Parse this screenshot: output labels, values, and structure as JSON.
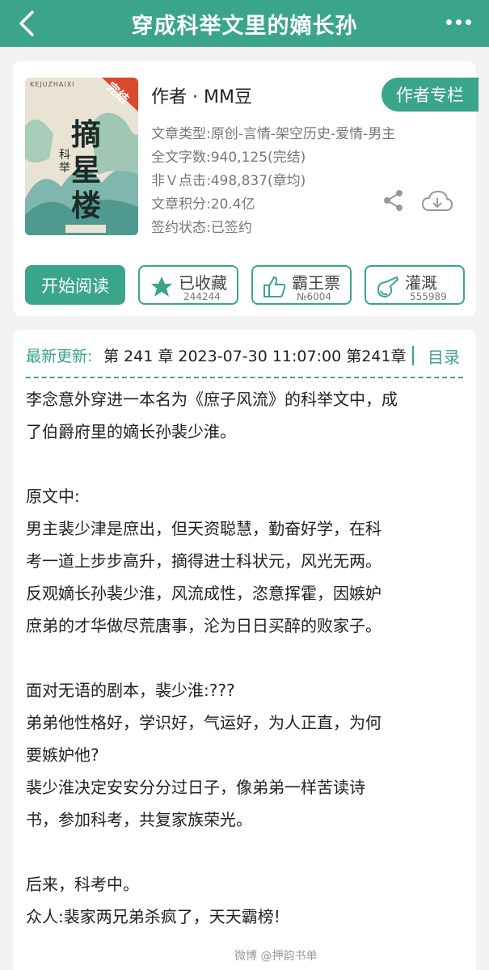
{
  "header": {
    "title": "穿成科举文里的嫡长孙"
  },
  "book": {
    "cover": {
      "badge": "完结",
      "title_chars": "摘星楼",
      "tag": "科举",
      "top_text": "KEJUZHAIXI"
    },
    "author": "作者 · MM豆",
    "author_column_label": "作者专栏",
    "meta": [
      "文章类型:原创-言情-架空历史-爱情-男主",
      "全文字数:940,125(完结)",
      "非Ｖ点击:498,837(章均)",
      "文章积分:20.4亿",
      "签约状态:已签约"
    ]
  },
  "actions": {
    "read_label": "开始阅读",
    "collect": {
      "label": "已收藏",
      "count": "244244"
    },
    "ticket": {
      "label": "霸王票",
      "count": "№6004"
    },
    "irrigate": {
      "label": "灌溉",
      "count": "555989"
    }
  },
  "update": {
    "label": "最新更新:",
    "value": "第 241 章 2023-07-30 11:07:00  第241章",
    "toc_label": "目录"
  },
  "description": [
    "李念意外穿进一本名为《庶子风流》的科举文中，成",
    "了伯爵府里的嫡长孙裴少淮。",
    "",
    "原文中:",
    "男主裴少津是庶出，但天资聪慧，勤奋好学，在科",
    "考一道上步步高升，摘得进士科状元，风光无两。",
    "反观嫡长孙裴少淮，风流成性，恣意挥霍，因嫉妒",
    "庶弟的才华做尽荒唐事，沦为日日买醉的败家子。",
    "",
    "面对无语的剧本，裴少淮:???",
    "弟弟他性格好，学识好，气运好，为人正直，为何",
    "要嫉妒他?",
    "裴少淮决定安安分分过日子，像弟弟一样苦读诗",
    "书，参加科考，共复家族荣光。",
    "",
    "后来，科考中。",
    "众人:裴家两兄弟杀疯了，天天霸榜!"
  ],
  "watermark": "微博 @押韵书单"
}
